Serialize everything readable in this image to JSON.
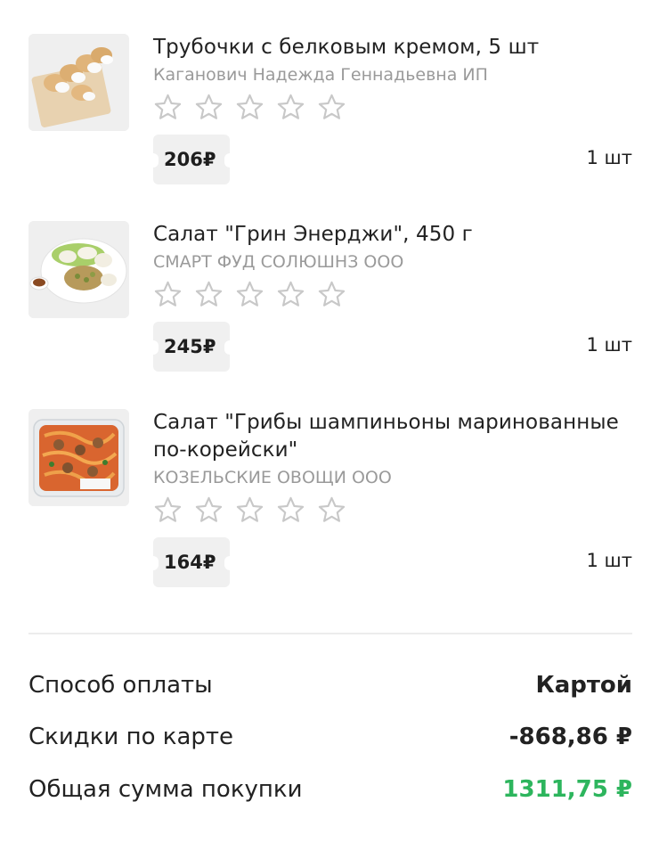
{
  "products": [
    {
      "title": "Трубочки с белковым кремом, 5 шт",
      "seller": "Каганович Надежда Геннадьевна ИП",
      "rating_stars": 0,
      "price": "206₽",
      "qty": "1 шт",
      "image_icon": "cream-rolls-photo"
    },
    {
      "title": "Салат \"Грин Энерджи\", 450 г",
      "seller": "СМАРТ ФУД СОЛЮШНЗ ООО",
      "rating_stars": 0,
      "price": "245₽",
      "qty": "1 шт",
      "image_icon": "salad-plate-photo"
    },
    {
      "title": "Салат \"Грибы шампиньоны маринованные по-корейски\"",
      "seller": "КОЗЕЛЬСКИЕ ОВОЩИ ООО",
      "rating_stars": 0,
      "price": "164₽",
      "qty": "1 шт",
      "image_icon": "mushroom-salad-container-photo"
    }
  ],
  "summary": {
    "payment_label": "Способ оплаты",
    "payment_value": "Картой",
    "discount_label": "Скидки по карте",
    "discount_value": "-868,86 ₽",
    "total_label": "Общая сумма покупки",
    "total_value": "1311,75 ₽"
  },
  "colors": {
    "total_accent": "#2db55d",
    "star_outline": "#c8c8c8",
    "seller_text": "#9a9a9a",
    "price_tag_bg": "#f0f0f0"
  }
}
